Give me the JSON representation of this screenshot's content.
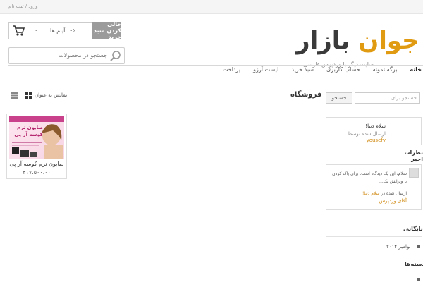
{
  "topbar": {
    "login_register": "ورود / ثبت نام"
  },
  "header": {
    "empty_cart_button": "خالی کردن سبد خرید",
    "cart_count": "۰",
    "cart_items_label": "آیتم ها",
    "cart_price": "۰٪",
    "search_placeholder": "جستجو در محصولات",
    "logo_part1": "جوان",
    "logo_part2": "بازار",
    "tagline": "سایت دیگر با وردپرس فارسی"
  },
  "nav": {
    "items": [
      {
        "label": "خانه",
        "active": true
      },
      {
        "label": "برگه نمونه",
        "active": false
      },
      {
        "label": "حساب کاربری",
        "active": false
      },
      {
        "label": "سبد خرید",
        "active": false
      },
      {
        "label": "لیست آرزو",
        "active": false
      },
      {
        "label": "پرداخت",
        "active": false
      }
    ]
  },
  "shop": {
    "title": "فروشگاه",
    "view_label": "نمایش به عنوان",
    "product": {
      "name": "صابون نرم کوسه آر پی",
      "price": "۴۱۷،۵۰۰،۰۰",
      "image_text_main": "صابون نرم",
      "image_text_sub": "کوسه آر پی"
    }
  },
  "sidebar": {
    "search_placeholder": "جستجو برای ...",
    "search_button": "جستجو",
    "post": {
      "title": "سلام دنیا!",
      "meta": "ارسال شده توسط",
      "author": "yousefv"
    },
    "recent_comments_title": "نظرات اخیر",
    "comment": {
      "text": "سلام، این یک دیدگاه است. برای پاک کردن یا ویرایش یک...",
      "meta_prefix": "ارسال شده در",
      "meta_link": "سلام دنیا!",
      "author": "آقای وردپرس"
    },
    "archives_title": "بایگانی",
    "archive_item": "نوامبر ۲۰۱۴",
    "categories_title": "دسته‌ها"
  }
}
